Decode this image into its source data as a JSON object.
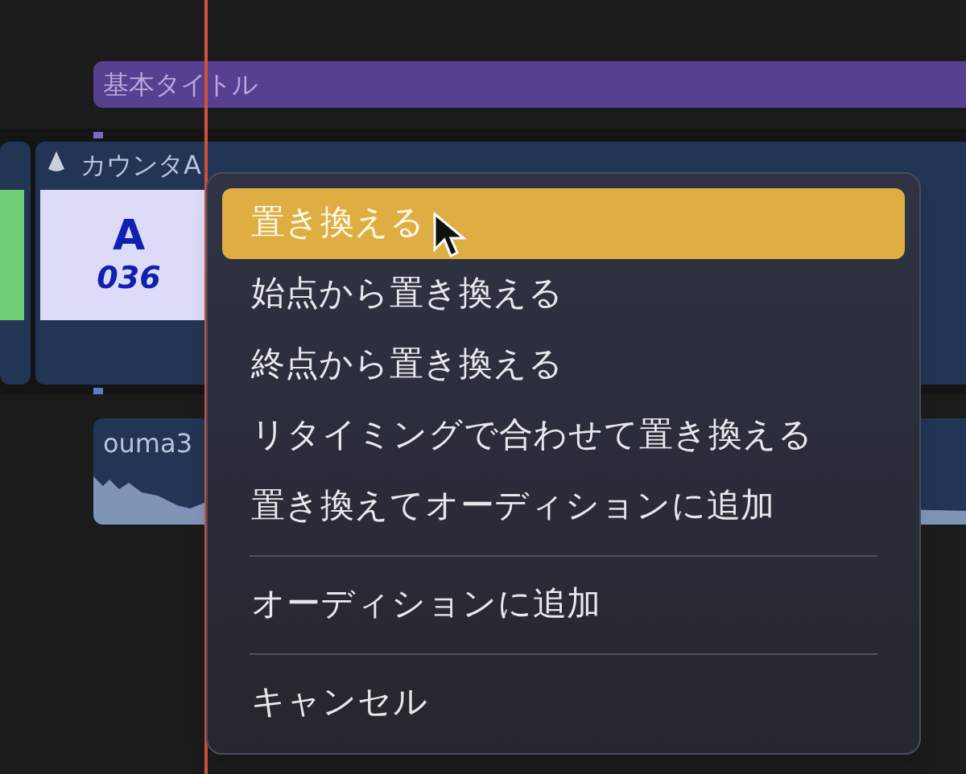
{
  "timeline": {
    "title_clip": {
      "label": "基本タイトル"
    },
    "video_clip": {
      "name": "カウンタA",
      "thumbnail": {
        "letter": "A",
        "number": "036"
      }
    },
    "audio_clip": {
      "name": "ouma3"
    }
  },
  "context_menu": {
    "items": [
      {
        "kind": "item",
        "label": "置き換える",
        "selected": true
      },
      {
        "kind": "item",
        "label": "始点から置き換える",
        "selected": false
      },
      {
        "kind": "item",
        "label": "終点から置き換える",
        "selected": false
      },
      {
        "kind": "item",
        "label": "リタイミングで合わせて置き換える",
        "selected": false
      },
      {
        "kind": "item",
        "label": "置き換えてオーディションに追加",
        "selected": false
      },
      {
        "kind": "separator"
      },
      {
        "kind": "item",
        "label": "オーディションに追加",
        "selected": false
      },
      {
        "kind": "separator"
      },
      {
        "kind": "item",
        "label": "キャンセル",
        "selected": false
      }
    ]
  }
}
